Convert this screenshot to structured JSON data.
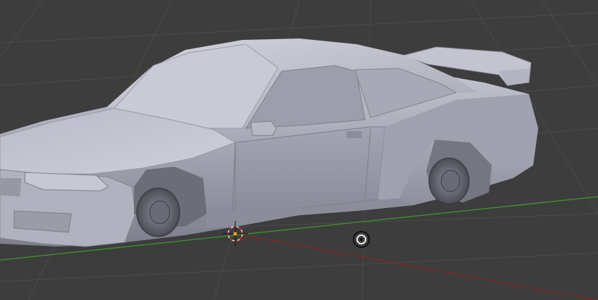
{
  "viewport": {
    "background": "#3d3d3d",
    "grid_color": "#4b4b4b",
    "x_axis_color": "#7a2a2a",
    "y_axis_color": "#3f8a2e",
    "model_color": "#a9aab8",
    "model_highlight": "#cfd0dc",
    "model_shadow": "#6e6f7d",
    "wheel_color": "#5c5d66"
  },
  "scene": {
    "object": "car-body-mesh",
    "cursor_icon": "3d-cursor-icon",
    "origin_icon": "object-origin-icon"
  }
}
